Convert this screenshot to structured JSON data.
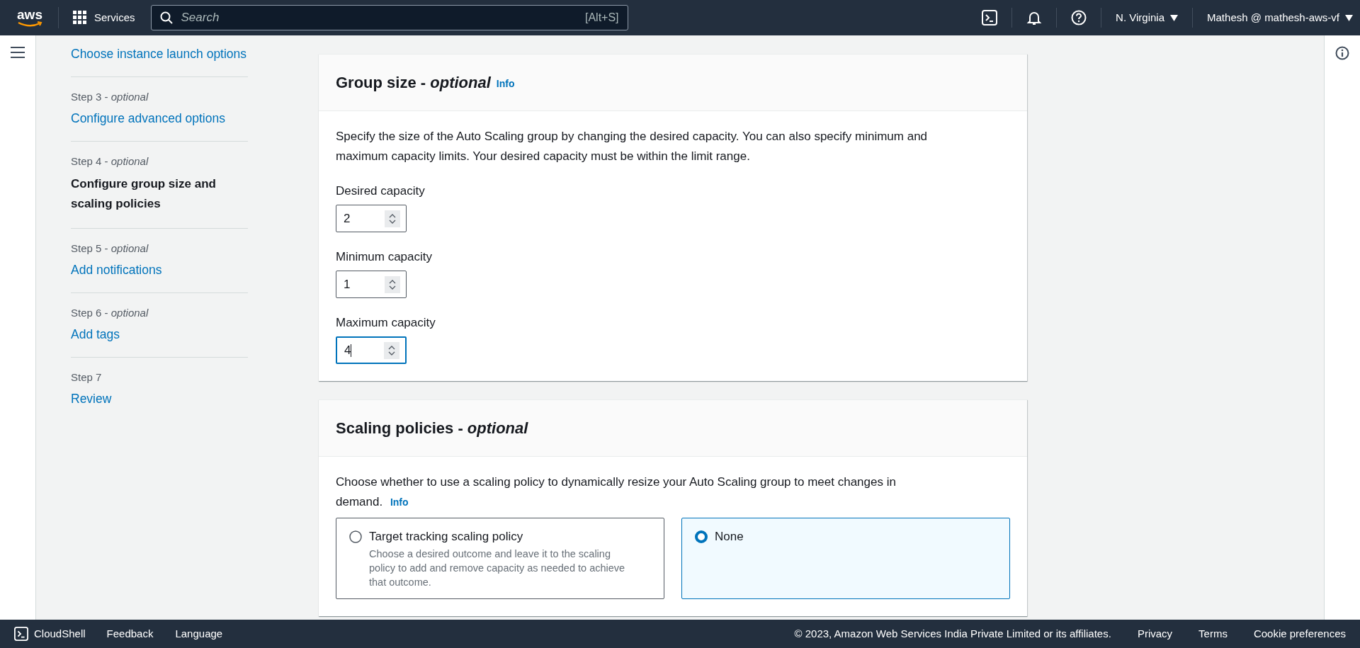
{
  "top_bar": {
    "logo": "aws",
    "services": "Services",
    "search": {
      "placeholder": "Search",
      "shortcut": "[Alt+S]"
    },
    "region": "N. Virginia",
    "account": "Mathesh @ mathesh-aws-vf"
  },
  "steps": [
    {
      "title": "Choose instance launch options",
      "selected": false
    },
    {
      "label": "Step 3 - *optional*",
      "title": "Configure advanced options",
      "selected": false
    },
    {
      "label": "Step 4 - *optional*",
      "title": "Configure group size and scaling policies",
      "selected": true
    },
    {
      "label": "Step 5 - *optional*",
      "title": "Add notifications",
      "selected": false
    },
    {
      "label": "Step 6 - *optional*",
      "title": "Add tags",
      "selected": false
    },
    {
      "label": "Step 7",
      "title": "Review",
      "selected": false
    }
  ],
  "group_size": {
    "title": "Group size - *optional*",
    "info": "Info",
    "description": "Specify the size of the Auto Scaling group by changing the desired capacity. You can also specify minimum and maximum capacity limits. Your desired capacity must be within the limit range.",
    "fields": [
      {
        "label": "Desired capacity",
        "value": "2",
        "focused": false
      },
      {
        "label": "Minimum capacity",
        "value": "1",
        "focused": false
      },
      {
        "label": "Maximum capacity",
        "value": "4",
        "focused": true
      }
    ]
  },
  "scaling_policies": {
    "title": "Scaling policies - *optional*",
    "description": "Choose whether to use a scaling policy to dynamically resize your Auto Scaling group to meet changes in demand.",
    "info": "Info",
    "options": [
      {
        "label": "Target tracking scaling policy",
        "description": "Choose a desired outcome and leave it to the scaling policy to add and remove capacity as needed to achieve that outcome.",
        "selected": false
      },
      {
        "label": "None",
        "selected": true
      }
    ]
  },
  "footer": {
    "cloudshell": "CloudShell",
    "feedback": "Feedback",
    "language": "Language",
    "copyright": "© 2023, Amazon Web Services India Private Limited or its affiliates.",
    "links": [
      "Privacy",
      "Terms",
      "Cookie preferences"
    ]
  }
}
